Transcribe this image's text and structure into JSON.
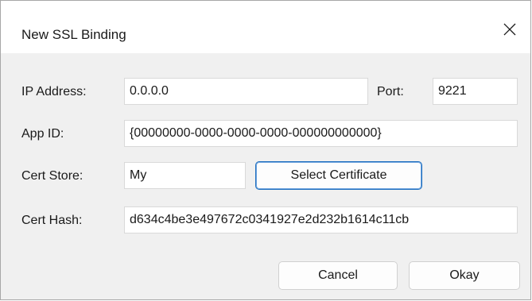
{
  "dialog": {
    "title": "New SSL Binding"
  },
  "form": {
    "ip_address": {
      "label": "IP Address:",
      "value": "0.0.0.0"
    },
    "port": {
      "label": "Port:",
      "value": "9221"
    },
    "app_id": {
      "label": "App ID:",
      "value": "{00000000-0000-0000-0000-000000000000}"
    },
    "cert_store": {
      "label": "Cert Store:",
      "value": "My"
    },
    "select_certificate_label": "Select Certificate",
    "cert_hash": {
      "label": "Cert Hash:",
      "value": "d634c4be3e497672c0341927e2d232b1614c11cb"
    }
  },
  "buttons": {
    "cancel_label": "Cancel",
    "okay_label": "Okay"
  },
  "icons": {
    "close": "close-icon"
  },
  "colors": {
    "accent": "#1f6fbf",
    "dialog_bg": "#f0f0f0",
    "titlebar_bg": "#ffffff"
  }
}
